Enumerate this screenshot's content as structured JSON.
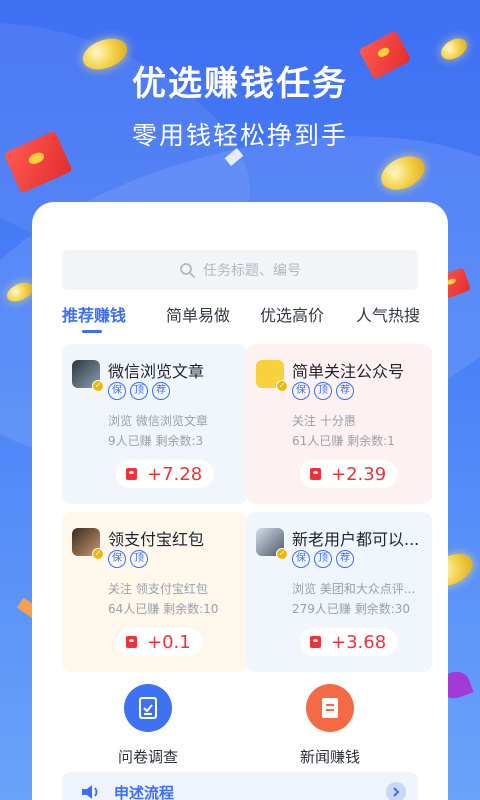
{
  "hero": {
    "title": "优选赚钱任务",
    "subtitle": "零用钱轻松挣到手"
  },
  "search": {
    "placeholder": "任务标题、编号"
  },
  "tabs": [
    {
      "label": "推荐赚钱",
      "active": true
    },
    {
      "label": "简单易做",
      "active": false
    },
    {
      "label": "优选高价",
      "active": false
    },
    {
      "label": "人气热搜",
      "active": false
    }
  ],
  "tasks": [
    {
      "title": "微信浏览文章",
      "tags": [
        "保",
        "顶",
        "荐"
      ],
      "desc": "浏览  微信浏览文章",
      "stats": "9人已赚  剩余数:3",
      "reward": "+7.28",
      "bg": "#f1f5fc"
    },
    {
      "title": "简单关注公众号",
      "tags": [
        "保",
        "顶",
        "荐"
      ],
      "desc": "关注  十分惠",
      "stats": "61人已赚  剩余数:1",
      "reward": "+2.39",
      "bg": "#fdf1f2"
    },
    {
      "title": "领支付宝红包",
      "tags": [
        "保",
        "顶"
      ],
      "desc": "关注  领支付宝红包",
      "stats": "64人已赚  剩余数:10",
      "reward": "+0.1",
      "bg": "#fdf7ec"
    },
    {
      "title": "新老用户都可以...",
      "tags": [
        "保",
        "顶",
        "荐"
      ],
      "desc": "浏览  美团和大众点评...",
      "stats": "279人已赚  剩余数:30",
      "reward": "+3.68",
      "bg": "#f1f5fc"
    }
  ],
  "shortcuts": [
    {
      "label": "问卷调查",
      "icon": "clipboard-check-icon",
      "color": "#3f72f2"
    },
    {
      "label": "新闻赚钱",
      "icon": "news-icon",
      "color": "#f36a45"
    }
  ],
  "process": {
    "label": "申述流程"
  },
  "colors": {
    "accent": "#3b6ff5",
    "reward": "#f0313a"
  }
}
